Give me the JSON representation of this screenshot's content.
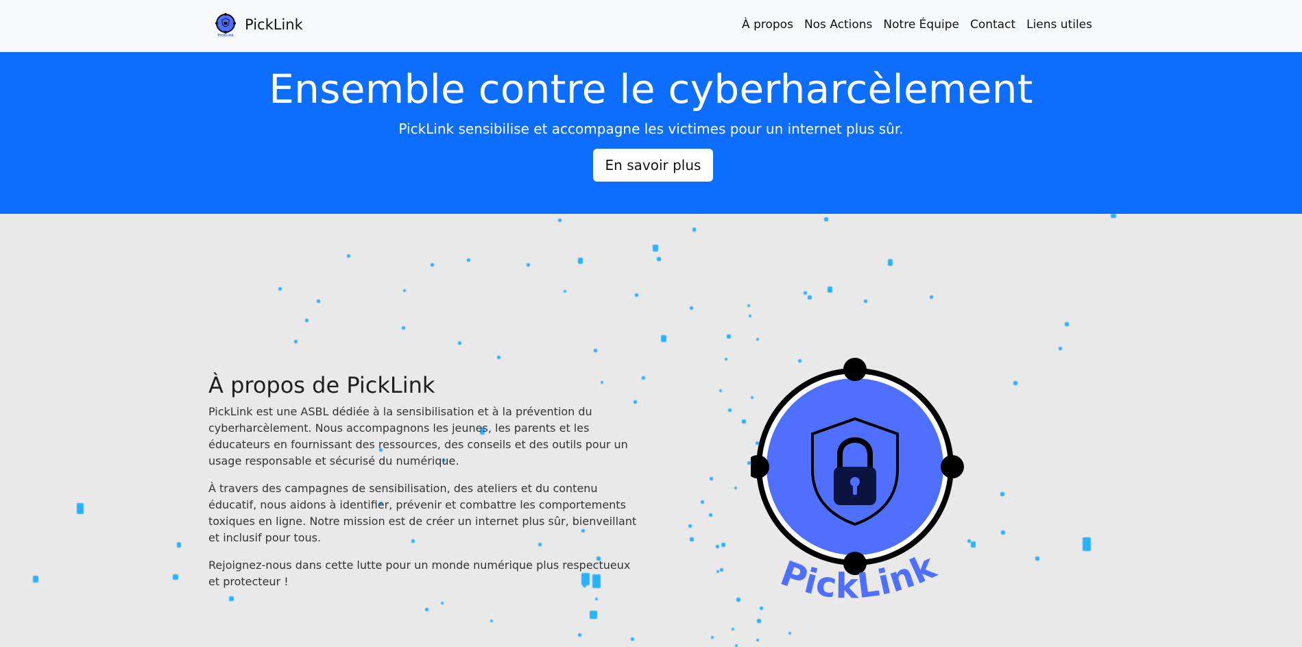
{
  "navbar": {
    "brand": "PickLink",
    "logo_icon": "picklink-logo-icon",
    "links": [
      "À propos",
      "Nos Actions",
      "Notre Équipe",
      "Contact",
      "Liens utiles"
    ]
  },
  "hero": {
    "title": "Ensemble contre le cyberharcèlement",
    "subtitle": "PickLink sensibilise et accompagne les victimes pour un internet plus sûr.",
    "button": "En savoir plus"
  },
  "about": {
    "title": "À propos de PickLink",
    "paragraphs": [
      "PickLink est une ASBL dédiée à la sensibilisation et à la prévention du cyberharcèlement. Nous accompagnons les jeunes, les parents et les éducateurs en fournissant des ressources, des conseils et des outils pour un usage responsable et sécurisé du numérique.",
      "À travers des campagnes de sensibilisation, des ateliers et du contenu éducatif, nous aidons à identifier, prévenir et combattre les comportements toxiques en ligne. Notre mission est de créer un internet plus sûr, bienveillant et inclusif pour tous.",
      "Rejoignez-nous dans cette lutte pour un monde numérique plus respectueux et protecteur !"
    ]
  },
  "logo": {
    "text": "PickLink",
    "icon": "shield-lock-icon"
  },
  "colors": {
    "hero_background": "#0d6efd",
    "logo_fill": "#4f6fff",
    "particle": "#2ab2ff"
  }
}
